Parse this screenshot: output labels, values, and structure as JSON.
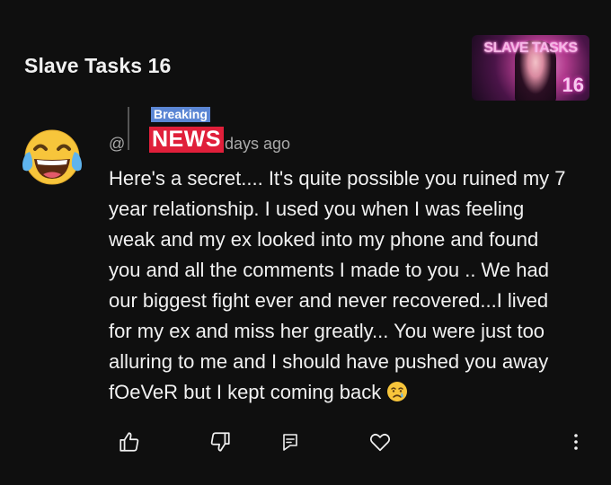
{
  "video": {
    "title": "Slave Tasks 16",
    "thumbnail": {
      "title_text": "SLAVE TASKS",
      "number_text": "16",
      "accent_color": "#ff4fd0"
    }
  },
  "comment": {
    "avatar_icon": "tears-of-joy-emoji-icon",
    "at_sign": "@",
    "badge": {
      "top_text": "Breaking",
      "main_text": "NEWS",
      "top_color": "#5b86d4",
      "main_color": "#e01f3a"
    },
    "time": "days ago",
    "text_lines": [
      "Here's a secret.... It's quite possible you ruined my 7",
      "year relationship. I used you when I was feeling",
      "weak and my ex looked into my phone and found",
      "you and all the comments I made to you .. We had",
      "our biggest fight ever and never recovered...I lived",
      "for my ex and miss her greatly... You were just too",
      "alluring to me and I should have pushed you away",
      "fOeVeR but I kept coming back"
    ],
    "trailing_emoji": "crying-face-emoji-icon"
  },
  "actions": {
    "like_icon": "thumbs-up-icon",
    "dislike_icon": "thumbs-down-icon",
    "reply_icon": "reply-comment-icon",
    "heart_icon": "heart-icon",
    "more_icon": "more-vertical-icon"
  },
  "colors": {
    "background": "#0f0f0f",
    "text_primary": "#f1f1f1",
    "text_secondary": "#aaaaaa"
  }
}
